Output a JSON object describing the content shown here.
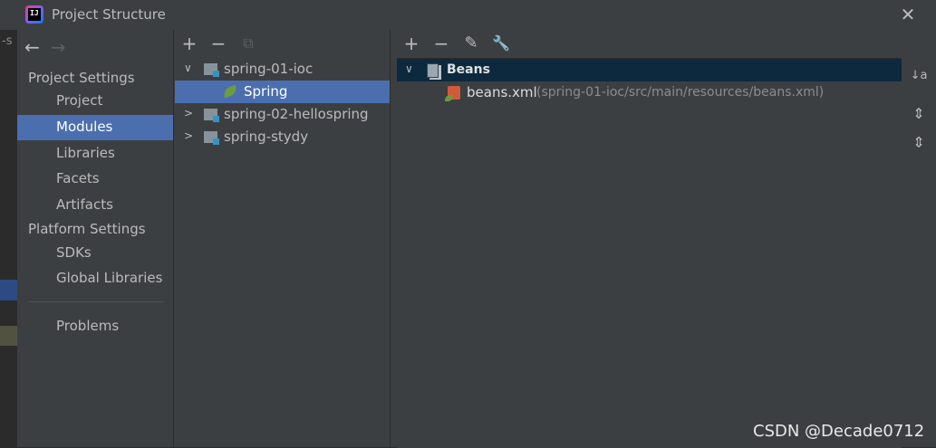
{
  "window": {
    "title": "Project Structure",
    "close_glyph": "✕"
  },
  "left_stub": {
    "text": "-s"
  },
  "nav": {
    "back_glyph": "←",
    "forward_glyph": "→",
    "project_settings_header": "Project Settings",
    "project_settings_items": [
      "Project",
      "Modules",
      "Libraries",
      "Facets",
      "Artifacts"
    ],
    "platform_settings_header": "Platform Settings",
    "platform_settings_items": [
      "SDKs",
      "Global Libraries"
    ],
    "problems": "Problems",
    "active_item": "Modules"
  },
  "modules_toolbar": {
    "add": "+",
    "remove": "−",
    "copy": "⧉"
  },
  "modules_tree": {
    "items": [
      {
        "label": "spring-01-ioc",
        "expanded": true
      },
      {
        "label": "Spring",
        "selected": true
      },
      {
        "label": "spring-02-hellospring",
        "expanded": false
      },
      {
        "label": "spring-stydy",
        "expanded": false
      }
    ]
  },
  "detail_toolbar": {
    "add": "+",
    "remove": "−",
    "edit": "✎",
    "settings": "🔧"
  },
  "beans": {
    "header": "Beans",
    "file_name": "beans.xml",
    "file_path": "(spring-01-ioc/src/main/resources/beans.xml)"
  },
  "side_tools": {
    "sort": "↓a",
    "expand": "⇕",
    "collapse": "⇔"
  },
  "watermark": "CSDN @Decade0712",
  "colors": {
    "selection": "#4b6eaf",
    "beans_header": "#0d293e",
    "background": "#3c3f41"
  }
}
